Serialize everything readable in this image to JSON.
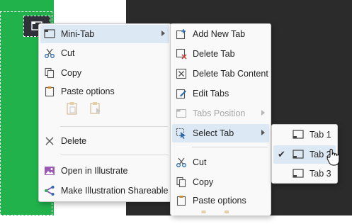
{
  "menu1": {
    "items": [
      {
        "label": "Mini-Tab",
        "icon": "mini-tab-icon",
        "submenu": true,
        "highlighted": true
      },
      {
        "label": "Cut",
        "icon": "scissors-icon"
      },
      {
        "label": "Copy",
        "icon": "copy-icon"
      }
    ],
    "paste_header": "Paste options",
    "delete": "Delete",
    "open_illustrate": "Open in Illustrate",
    "make_shareable": "Make Illustration Shareable"
  },
  "menu2": {
    "items": [
      {
        "label": "Add New Tab",
        "icon": "add-tab-icon"
      },
      {
        "label": "Delete Tab",
        "icon": "delete-tab-icon"
      },
      {
        "label": "Delete Tab Content",
        "icon": "delete-content-icon"
      },
      {
        "label": "Edit Tabs",
        "icon": "edit-icon"
      },
      {
        "label": "Tabs Position",
        "icon": "tabs-position-icon",
        "disabled": true,
        "submenu": true
      },
      {
        "label": "Select Tab",
        "icon": "select-cursor-icon",
        "submenu": true,
        "highlighted": true
      },
      {
        "label": "Cut",
        "icon": "scissors-icon"
      },
      {
        "label": "Copy",
        "icon": "copy-icon"
      }
    ],
    "paste_header": "Paste options"
  },
  "menu3": {
    "items": [
      {
        "label": "Tab 1",
        "checked": false
      },
      {
        "label": "Tab 2",
        "checked": true,
        "highlighted": true
      },
      {
        "label": "Tab 3",
        "checked": false
      }
    ]
  },
  "colors": {
    "accent": "#21b24b",
    "highlight": "#dde8f5",
    "dark": "#2b2b2b"
  }
}
